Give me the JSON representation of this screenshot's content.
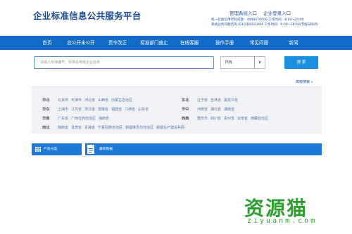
{
  "header": {
    "title": "企业标准信息公共服务平台",
    "links": [
      "管理系统入口",
      "企业登录入口"
    ],
    "hotline_line1": "统一社会信用代码问题：4008076000 工作时间：8:00~20:00",
    "hotline_line2": "系统业务问题咨询 (010)82021084 工作时间：9:00~18:00(节假日除外)"
  },
  "nav": {
    "items": [
      "首页",
      "应公开未公开",
      "责令改正",
      "标准部门废止",
      "在线客服",
      "操作手册",
      "常见问题",
      "新闻"
    ]
  },
  "search": {
    "placeholder": "请输入标准编号、标准名称或企业名称",
    "select_value": "所有",
    "select_arrow": "∨",
    "button_label": "搜 索"
  },
  "advanced_search": "高级搜索 »",
  "regions": [
    {
      "name": "华北",
      "provinces": [
        "北京市",
        "天津市",
        "河北省",
        "山西省",
        "内蒙古自治区"
      ]
    },
    {
      "name": "东北",
      "provinces": [
        "辽宁省",
        "吉林省",
        "黑龙江省"
      ]
    },
    {
      "name": "华东",
      "provinces": [
        "上海市",
        "江苏省",
        "浙江省",
        "安徽省",
        "福建省",
        "江西省",
        "山东省"
      ]
    },
    {
      "name": "华中",
      "provinces": [
        "河南省",
        "湖北省",
        "湖南省"
      ]
    },
    {
      "name": "华南",
      "provinces": [
        "广东省",
        "广西壮族自治区",
        "海南省"
      ]
    },
    {
      "name": "西南",
      "provinces": [
        "重庆市",
        "四川省",
        "贵州省",
        "云南省",
        "西藏自治区"
      ]
    },
    {
      "name": "西北",
      "provinces": [
        "陕西省",
        "甘肃省",
        "青海省",
        "宁夏回族自治区",
        "新疆维吾尔自治区",
        "新疆生产建设兵团"
      ]
    }
  ],
  "bottom_tabs": {
    "left_label": "产品分类",
    "right_label": "最新数据"
  },
  "watermark": {
    "main": "资源猫",
    "sub": "ziyuanm.com"
  },
  "colors": {
    "brand": "#1b4d98",
    "nav_bg": "#1169c8",
    "button": "#1a8fe0",
    "watermark": "#2e9e2e"
  }
}
